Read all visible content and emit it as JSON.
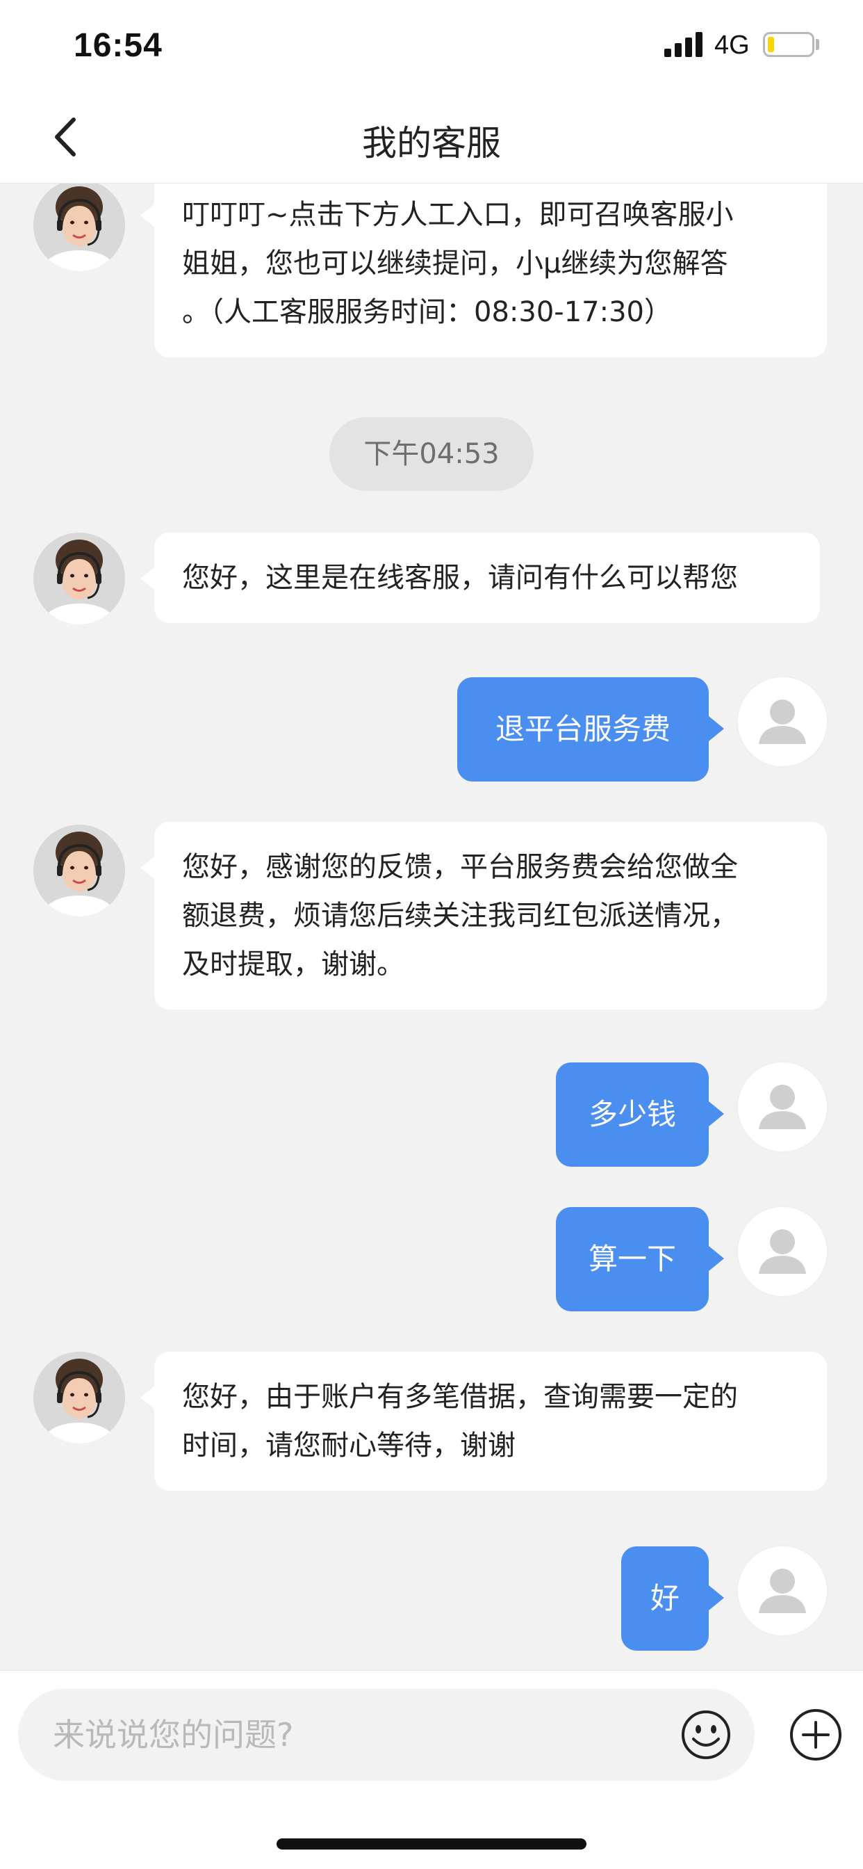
{
  "status_bar": {
    "time": "16:54",
    "network": "4G",
    "battery_level": 0.15
  },
  "nav": {
    "title": "我的客服",
    "back_icon": "chevron-left-icon"
  },
  "chat": {
    "messages": [
      {
        "role": "agent",
        "lines": [
          "叮叮叮~点击下方人工入口，即可召唤客服小",
          "姐姐，您也可以继续提问，小μ继续为您解答",
          "。（人工客服服务时间：08:30-17:30）"
        ]
      },
      {
        "role": "time",
        "text": "下午04:53"
      },
      {
        "role": "agent",
        "lines": [
          "您好，这里是在线客服，请问有什么可以帮您"
        ]
      },
      {
        "role": "user",
        "text": "退平台服务费"
      },
      {
        "role": "agent",
        "lines": [
          "您好，感谢您的反馈，平台服务费会给您做全",
          "额退费，烦请您后续关注我司红包派送情况，",
          "及时提取，谢谢。"
        ]
      },
      {
        "role": "user",
        "text": "多少钱"
      },
      {
        "role": "user",
        "text": "算一下"
      },
      {
        "role": "agent",
        "lines": [
          "您好，由于账户有多笔借据，查询需要一定的",
          "时间，请您耐心等待，谢谢"
        ]
      },
      {
        "role": "user",
        "text": "好"
      }
    ]
  },
  "input": {
    "placeholder": "来说说您的问题?",
    "emoji_icon": "emoji-icon",
    "plus_icon": "plus-circle-icon"
  },
  "colors": {
    "user_bubble": "#4a8eef",
    "background": "#f2f2f2",
    "agent_bubble": "#ffffff"
  }
}
